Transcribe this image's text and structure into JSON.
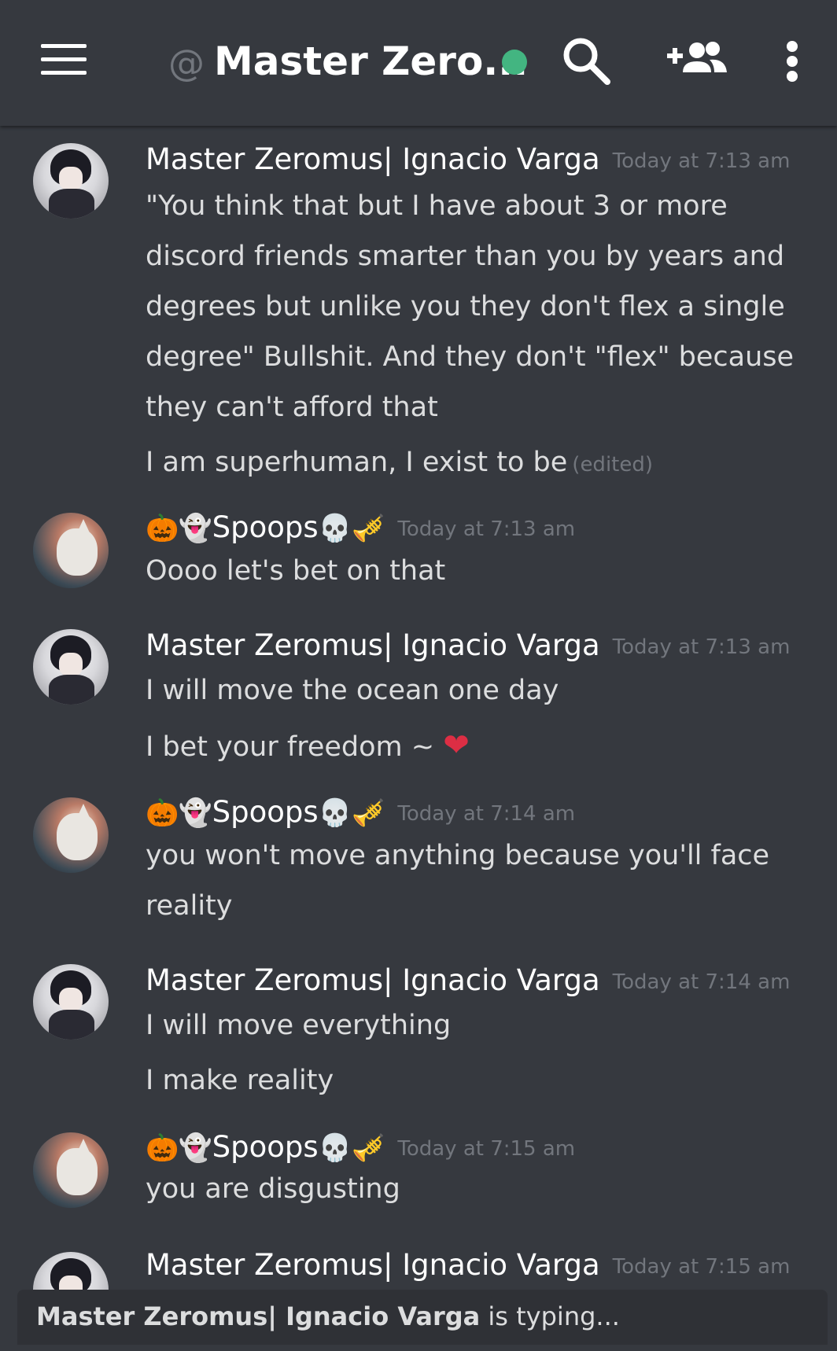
{
  "header": {
    "at_sign": "@",
    "channel_name": "Master Zero...",
    "icons": [
      "menu-icon",
      "search-icon",
      "add-friend-icon",
      "more-vertical-icon"
    ],
    "online_color": "#43b581"
  },
  "messages": [
    {
      "author": "Master Zeromus| Ignacio Varga",
      "timestamp": "Today at 7:13 am",
      "lines": [
        "\"You think that but I have about 3 or more",
        "discord friends smarter than you by years and",
        "degrees but unlike you they don't flex a single",
        "degree\" Bullshit. And they don't \"flex\" because",
        "they can't afford that"
      ],
      "extra_line": "I am superhuman, I exist to be",
      "edited": "(edited)"
    },
    {
      "author_prefix": "🎃👻",
      "author": "Spoops",
      "author_suffix": "💀🎺",
      "timestamp": "Today at 7:13 am",
      "lines": [
        "Oooo let's bet on that"
      ]
    },
    {
      "author": "Master Zeromus| Ignacio Varga",
      "timestamp": "Today at 7:13 am",
      "lines": [
        "I will move the ocean one day"
      ],
      "extra_line": "I bet your freedom ~",
      "extra_emoji": "❤"
    },
    {
      "author_prefix": "🎃👻",
      "author": "Spoops",
      "author_suffix": "💀🎺",
      "timestamp": "Today at 7:14 am",
      "lines": [
        "you won't move anything because you'll face",
        "reality"
      ]
    },
    {
      "author": "Master Zeromus| Ignacio Varga",
      "timestamp": "Today at 7:14 am",
      "lines": [
        "I will move everything"
      ],
      "extra_line": "I make reality"
    },
    {
      "author_prefix": "🎃👻",
      "author": "Spoops",
      "author_suffix": "💀🎺",
      "timestamp": "Today at 7:15 am",
      "lines": [
        "you are disgusting"
      ]
    },
    {
      "author": "Master Zeromus| Ignacio Varga",
      "timestamp": "Today at 7:15 am"
    }
  ],
  "typing": {
    "user": "Master Zeromus| Ignacio Varga",
    "suffix": "is typing..."
  }
}
